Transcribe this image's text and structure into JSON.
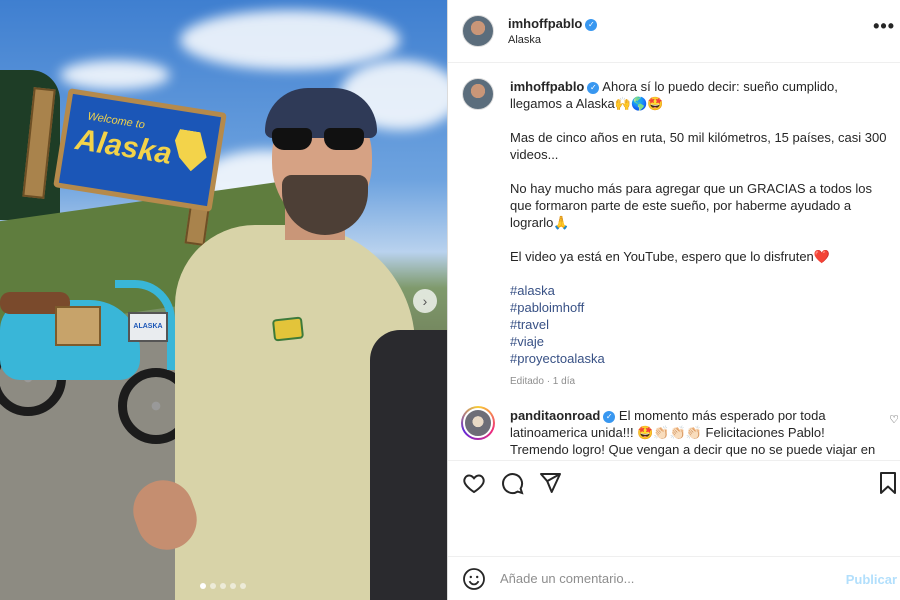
{
  "post": {
    "username": "imhoffpablo",
    "location": "Alaska",
    "photo_sign_welcome": "Welcome to",
    "photo_sign_alaska": "Alaska",
    "moto_plate": "ALASKA",
    "carousel_dots": 5,
    "carousel_active": 1
  },
  "caption": {
    "username": "imhoffpablo",
    "line1": "Ahora sí lo puedo decir: sueño cumplido, llegamos a Alaska🙌🌎🤩",
    "line2": "Mas de cinco años en ruta, 50 mil kilómetros, 15 países, casi 300 videos...",
    "line3": "No hay mucho más para agregar que un GRACIAS a todos los que formaron parte de este sueño, por haberme ayudado a lograrlo🙏",
    "line4": "El video ya está en YouTube, espero que lo disfruten❤️",
    "hashtags": [
      "#alaska",
      "#pabloimhoff",
      "#travel",
      "#viaje",
      "#proyectoalaska"
    ],
    "edited": "Editado · 1 día"
  },
  "comment": {
    "username": "panditaonroad",
    "text": "El momento más esperado por toda latinoamerica unida!!! 🤩👏🏻👏🏻👏🏻 Felicitaciones Pablo! Tremendo logro! Que vengan a decir que no se puede viajar en"
  },
  "add_comment": {
    "placeholder": "Añade un comentario...",
    "publish_label": "Publicar"
  },
  "icons": {
    "more": "more-icon",
    "like": "heart-icon",
    "comment": "comment-icon",
    "share": "share-icon",
    "save": "bookmark-icon",
    "emoji": "emoji-icon",
    "verified": "verified-badge-icon"
  },
  "colors": {
    "link": "#385185",
    "verified": "#3897f0",
    "publish_disabled": "#b2dffc"
  }
}
